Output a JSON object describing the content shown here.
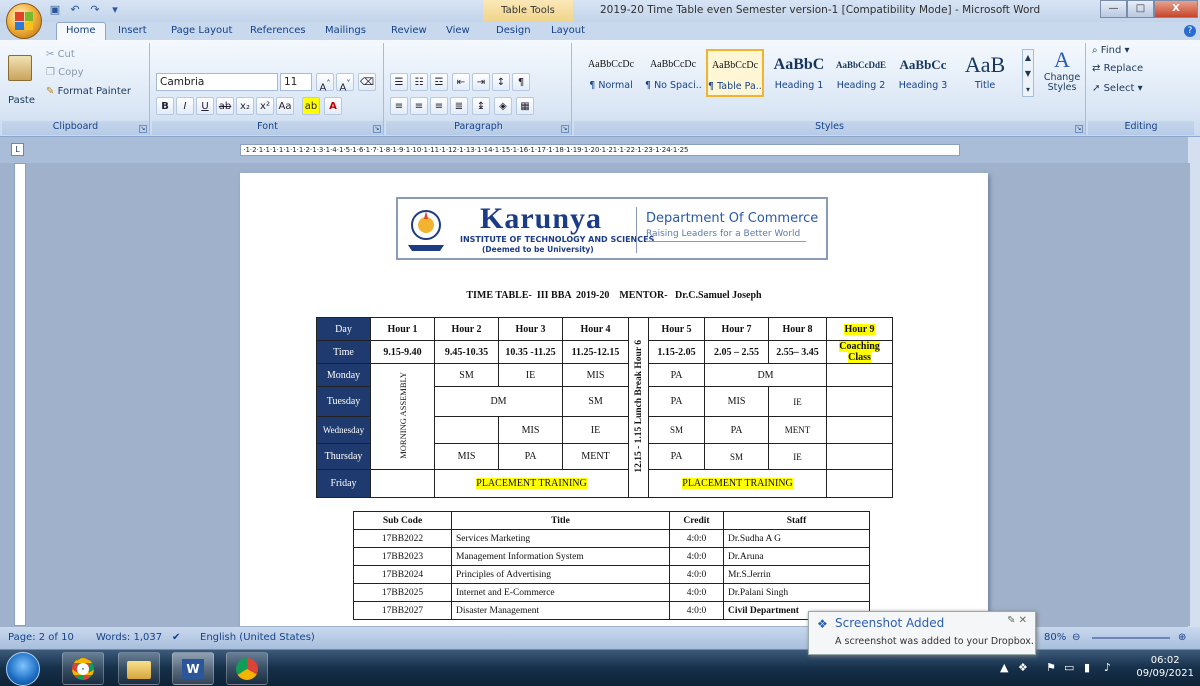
{
  "window": {
    "title": "2019-20 Time Table even Semester version-1 [Compatibility Mode] - Microsoft Word",
    "contextual_tab": "Table Tools",
    "controls": [
      "—",
      "□",
      "X"
    ]
  },
  "tabs": [
    {
      "label": "Home"
    },
    {
      "label": "Insert"
    },
    {
      "label": "Page Layout"
    },
    {
      "label": "References"
    },
    {
      "label": "Mailings"
    },
    {
      "label": "Review"
    },
    {
      "label": "View"
    },
    {
      "label": "Design"
    },
    {
      "label": "Layout"
    }
  ],
  "clipboard": {
    "paste": "Paste",
    "cut": "Cut",
    "copy": "Copy",
    "format_painter": "Format Painter",
    "label": "Clipboard"
  },
  "font": {
    "family": "Cambria",
    "size": "11",
    "label": "Font"
  },
  "paragraph": {
    "label": "Paragraph"
  },
  "styles": {
    "items": [
      {
        "preview": "AaBbCcDc",
        "name": "¶ Normal"
      },
      {
        "preview": "AaBbCcDc",
        "name": "¶ No Spaci..."
      },
      {
        "preview": "AaBbCcDc",
        "name": "¶ Table Pa..."
      },
      {
        "preview": "AaBbC",
        "name": "Heading 1"
      },
      {
        "preview": "AaBbCcDdE",
        "name": "Heading 2"
      },
      {
        "preview": "AaBbCc",
        "name": "Heading 3"
      },
      {
        "preview": "AaB",
        "name": "Title"
      }
    ],
    "change_styles": "Change Styles",
    "label": "Styles"
  },
  "editing": {
    "find": "Find",
    "replace": "Replace",
    "select": "Select",
    "label": "Editing"
  },
  "document": {
    "logo": {
      "name": "Karunya",
      "institute": "INSTITUTE OF TECHNOLOGY AND SCIENCES",
      "deemed": "(Deemed to be University)",
      "department": "Department Of Commerce",
      "tagline": "Raising Leaders for a Better World"
    },
    "tt_title": "TIME TABLE-  III BBA  2019-20    MENTOR-   Dr.C.Samuel Joseph",
    "timetable": {
      "day_header": "Day",
      "hours": [
        "Hour 1",
        "Hour 2",
        "Hour 3",
        "Hour 4",
        "Hour 5",
        "Hour 7",
        "Hour 8",
        "Hour 9"
      ],
      "time_label": "Time",
      "times": [
        "9.15-9.40",
        "9.45-10.35",
        "10.35 -11.25",
        "11.25-12.15",
        "1.15-2.05",
        "2.05 – 2.55",
        "2.55– 3.45",
        "Coaching Class"
      ],
      "lunch": "12.15 - 1.15 Lunch Break Hour 6",
      "assembly": "MORNING ASSEMBLY",
      "days": [
        "Monday",
        "Tuesday",
        "Wednesday",
        "Thursday",
        "Friday"
      ],
      "monday": {
        "h2": "SM",
        "h3": "IE",
        "h4": "MIS",
        "h5": "PA",
        "h78": "DM"
      },
      "tuesday": {
        "h23": "DM",
        "h4": "SM",
        "h5": "PA",
        "h7": "MIS",
        "h8": "IE"
      },
      "wednesday": {
        "h3": "MIS",
        "h4": "IE",
        "h5": "SM",
        "h7": "PA",
        "h8": "MENT"
      },
      "thursday": {
        "h2": "MIS",
        "h3": "PA",
        "h4": "MENT",
        "h5": "PA",
        "h7": "SM",
        "h8": "IE"
      },
      "friday": {
        "am": "PLACEMENT TRAINING",
        "pm": "PLACEMENT TRAINING"
      }
    },
    "subjects": {
      "headers": [
        "Sub Code",
        "Title",
        "Credit",
        "Staff"
      ],
      "rows": [
        [
          "17BB2022",
          "Services Marketing",
          "4:0:0",
          "Dr.Sudha A G"
        ],
        [
          "17BB2023",
          "Management Information System",
          "4:0:0",
          "Dr.Aruna"
        ],
        [
          "17BB2024",
          "Principles of Advertising",
          "4:0:0",
          "Mr.S.Jerrin"
        ],
        [
          "17BB2025",
          "Internet and E-Commerce",
          "4:0:0",
          "Dr.Palani Singh"
        ],
        [
          "17BB2027",
          "Disaster Management",
          "4:0:0",
          "Civil Department"
        ]
      ]
    }
  },
  "status": {
    "page": "Page: 2 of 10",
    "words": "Words: 1,037",
    "language": "English (United States)",
    "zoom": "80%"
  },
  "toast": {
    "title": "Screenshot Added",
    "body": "A screenshot was added to your Dropbox."
  },
  "clock": {
    "time": "06:02",
    "date": "09/09/2021"
  }
}
